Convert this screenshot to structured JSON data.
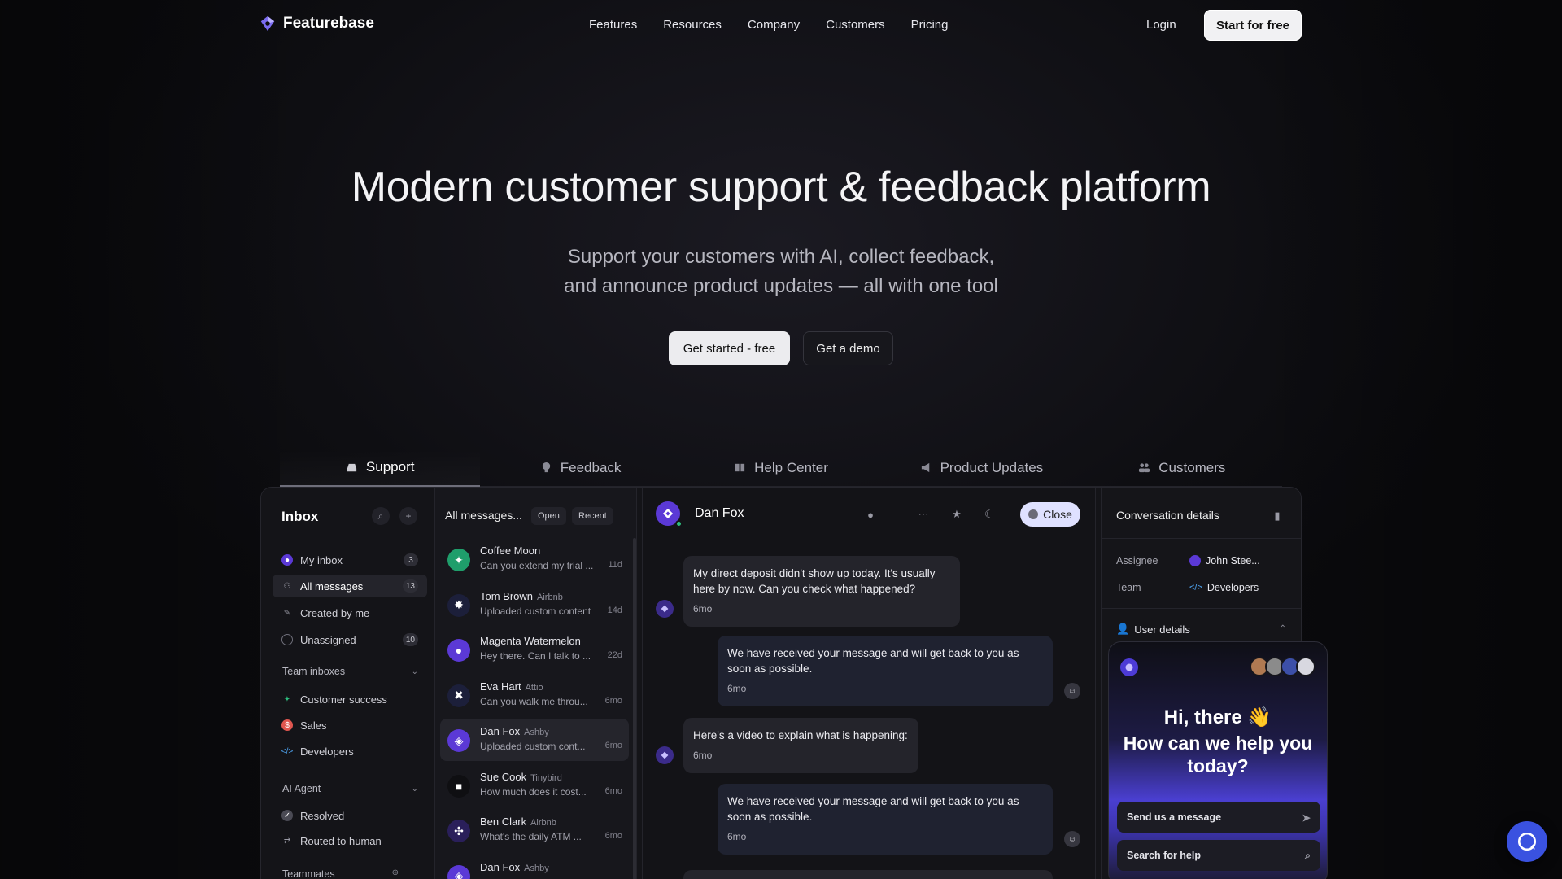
{
  "nav": {
    "brand": "Featurebase",
    "links": [
      "Features",
      "Resources",
      "Company",
      "Customers",
      "Pricing"
    ],
    "login": "Login",
    "start": "Start for free"
  },
  "hero": {
    "title": "Modern customer support & feedback platform",
    "subtitle_line1": "Support your customers with AI, collect feedback,",
    "subtitle_line2": "and announce product updates — all with one tool",
    "cta_primary": "Get started - free",
    "cta_secondary": "Get a demo"
  },
  "tabs": [
    "Support",
    "Feedback",
    "Help Center",
    "Product Updates",
    "Customers"
  ],
  "inbox": {
    "title": "Inbox",
    "items": [
      {
        "label": "My inbox",
        "count": "3"
      },
      {
        "label": "All messages",
        "count": "13"
      },
      {
        "label": "Created by me",
        "count": ""
      },
      {
        "label": "Unassigned",
        "count": "10"
      }
    ],
    "team_section": "Team inboxes",
    "teams": [
      "Customer success",
      "Sales",
      "Developers"
    ],
    "ai_section": "AI Agent",
    "ai_items": [
      "Resolved",
      "Routed to human"
    ],
    "teammates_section": "Teammates"
  },
  "list": {
    "header": "All messages...",
    "pill_open": "Open",
    "pill_recent": "Recent",
    "rows": [
      {
        "name": "Coffee Moon",
        "company": "",
        "preview": "Can you extend my trial ...",
        "time": "11d",
        "color": "#1f9e6b",
        "icon": "✦"
      },
      {
        "name": "Tom Brown",
        "company": "Airbnb",
        "preview": "Uploaded custom content",
        "time": "14d",
        "color": "#1c1f3a",
        "icon": "✸"
      },
      {
        "name": "Magenta Watermelon",
        "company": "",
        "preview": "Hey there. Can I talk to ...",
        "time": "22d",
        "color": "#5b39d6",
        "icon": "●"
      },
      {
        "name": "Eva Hart",
        "company": "Attio",
        "preview": "Can you walk me throu...",
        "time": "6mo",
        "color": "#1c1f3a",
        "icon": "✖"
      },
      {
        "name": "Dan Fox",
        "company": "Ashby",
        "preview": "Uploaded custom cont...",
        "time": "6mo",
        "color": "#5b39d6",
        "icon": "◈"
      },
      {
        "name": "Sue Cook",
        "company": "Tinybird",
        "preview": "How much does it cost...",
        "time": "6mo",
        "color": "#0f0f12",
        "icon": "■"
      },
      {
        "name": "Ben Clark",
        "company": "Airbnb",
        "preview": "What's the daily ATM ...",
        "time": "6mo",
        "color": "#2a1f5a",
        "icon": "✣"
      },
      {
        "name": "Dan Fox",
        "company": "Ashby",
        "preview": "",
        "time": "",
        "color": "#5b39d6",
        "icon": "◈"
      }
    ]
  },
  "chat": {
    "name": "Dan Fox",
    "close": "Close",
    "messages": [
      {
        "text": "My direct deposit didn't show up today. It's usually here by now. Can you check what happened?",
        "time": "6mo"
      },
      {
        "text": "We have received your message and will get back to you as soon as possible.",
        "time": "6mo"
      },
      {
        "text": "Here's a video to explain what is happening:",
        "time": "6mo"
      },
      {
        "text": "We have received your message and will get back to you as soon as possible.",
        "time": "6mo"
      }
    ]
  },
  "details": {
    "title": "Conversation details",
    "assignee_label": "Assignee",
    "assignee": "John Stee...",
    "team_label": "Team",
    "team": "Developers",
    "user_details": "User details"
  },
  "widget": {
    "greeting": "Hi, there 👋",
    "question": "How can we help you today?",
    "send": "Send us a message",
    "search": "Search for help"
  },
  "colors": {
    "accent": "#5b39d6",
    "fab": "#3a52e0"
  }
}
